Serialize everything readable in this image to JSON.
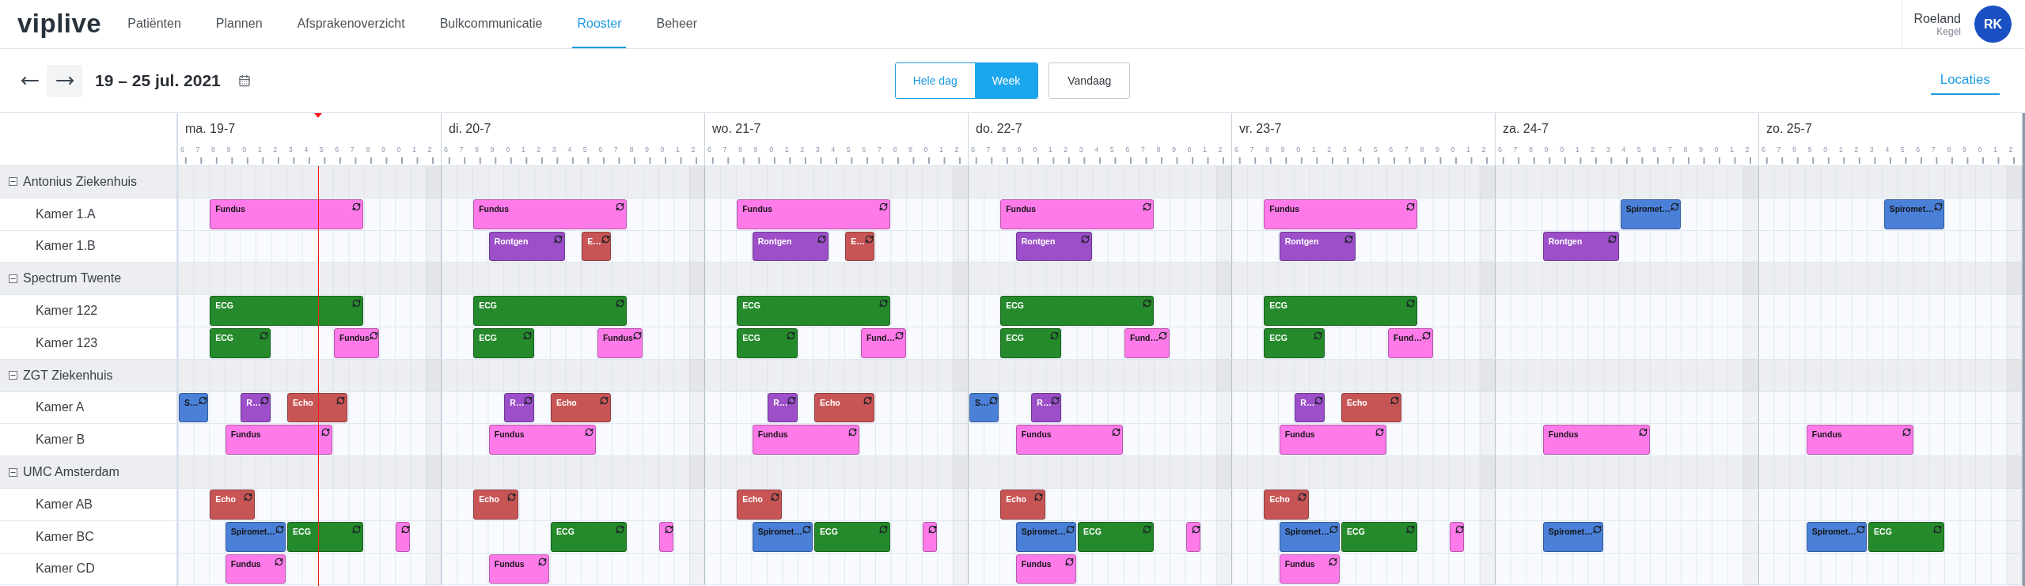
{
  "nav": {
    "logo": "viplive",
    "items": [
      {
        "label": "Patiënten",
        "selected": false
      },
      {
        "label": "Plannen",
        "selected": false
      },
      {
        "label": "Afsprakenoverzicht",
        "selected": false
      },
      {
        "label": "Bulkcommunicatie",
        "selected": false
      },
      {
        "label": "Rooster",
        "selected": true
      },
      {
        "label": "Beheer",
        "selected": false
      }
    ]
  },
  "user": {
    "first_name": "Roeland",
    "last_name": "Kegel",
    "initials": "RK"
  },
  "toolbar": {
    "range_title": "19 – 25 jul. 2021",
    "view_toggle": [
      {
        "label": "Hele dag",
        "selected": false
      },
      {
        "label": "Week",
        "selected": true
      }
    ],
    "today_button": "Vandaag",
    "tabs": [
      {
        "label": "Locaties",
        "selected": true
      }
    ]
  },
  "timeline": {
    "days": [
      {
        "label": "ma. 19-7",
        "hours": [
          "6",
          "7",
          "8",
          "9",
          "0",
          "1",
          "2",
          "3",
          "4",
          "5",
          "6",
          "7",
          "8",
          "9",
          "0",
          "1",
          "2"
        ]
      },
      {
        "label": "di. 20-7",
        "hours": [
          "6",
          "7",
          "8",
          "9",
          "0",
          "1",
          "2",
          "3",
          "4",
          "5",
          "6",
          "7",
          "8",
          "9",
          "0",
          "1",
          "2"
        ]
      },
      {
        "label": "wo. 21-7",
        "hours": [
          "6",
          "7",
          "8",
          "9",
          "0",
          "1",
          "2",
          "3",
          "4",
          "5",
          "6",
          "7",
          "8",
          "9",
          "0",
          "1",
          "2"
        ]
      },
      {
        "label": "do. 22-7",
        "hours": [
          "6",
          "7",
          "8",
          "9",
          "0",
          "1",
          "2",
          "3",
          "4",
          "5",
          "6",
          "7",
          "8",
          "9",
          "0",
          "1",
          "2"
        ]
      },
      {
        "label": "vr. 23-7",
        "hours": [
          "6",
          "7",
          "8",
          "9",
          "0",
          "1",
          "2",
          "3",
          "4",
          "5",
          "6",
          "7",
          "8",
          "9",
          "0",
          "1",
          "2"
        ]
      },
      {
        "label": "za. 24-7",
        "hours": [
          "6",
          "7",
          "8",
          "9",
          "0",
          "1",
          "2",
          "3",
          "4",
          "5",
          "6",
          "7",
          "8",
          "9",
          "0",
          "1",
          "2"
        ]
      },
      {
        "label": "zo. 25-7",
        "hours": [
          "6",
          "7",
          "8",
          "9",
          "0",
          "1",
          "2",
          "3",
          "4",
          "5",
          "6",
          "7",
          "8",
          "9",
          "0",
          "1",
          "2"
        ]
      }
    ]
  },
  "groups": [
    {
      "name": "Antonius Ziekenhuis",
      "expanded": true,
      "rooms": [
        {
          "name": "Kamer 1.A",
          "events": [
            {
              "label": "Fundus",
              "color": "#ff7ae9",
              "recurring": true
            },
            {
              "label": "Fundus",
              "color": "#ff7ae9",
              "recurring": true
            },
            {
              "label": "Fundus",
              "color": "#ff7ae9",
              "recurring": true
            },
            {
              "label": "Fundus",
              "color": "#ff7ae9",
              "recurring": true
            },
            {
              "label": "Fundus",
              "color": "#ff7ae9",
              "recurring": true
            },
            {
              "label": "Spiromet…",
              "color": "#4a80d8",
              "recurring": true
            },
            {
              "label": "Spiromet…",
              "color": "#4a80d8",
              "recurring": true
            }
          ]
        },
        {
          "name": "Kamer 1.B",
          "events": [
            {
              "label": "Rontgen",
              "color": "#9c4fc8",
              "recurring": true
            },
            {
              "label": "E…",
              "color": "#c85555",
              "recurring": true
            },
            {
              "label": "Rontgen",
              "color": "#9c4fc8",
              "recurring": true
            },
            {
              "label": "E…",
              "color": "#c85555",
              "recurring": true
            },
            {
              "label": "Rontgen",
              "color": "#9c4fc8",
              "recurring": true
            },
            {
              "label": "Rontgen",
              "color": "#9c4fc8",
              "recurring": true
            },
            {
              "label": "Rontgen",
              "color": "#9c4fc8",
              "recurring": true
            }
          ]
        }
      ]
    },
    {
      "name": "Spectrum Twente",
      "expanded": true,
      "rooms": [
        {
          "name": "Kamer 122",
          "events": [
            {
              "label": "ECG",
              "color": "#258a2b",
              "recurring": true
            },
            {
              "label": "ECG",
              "color": "#258a2b",
              "recurring": true
            },
            {
              "label": "ECG",
              "color": "#258a2b",
              "recurring": true
            },
            {
              "label": "ECG",
              "color": "#258a2b",
              "recurring": true
            },
            {
              "label": "ECG",
              "color": "#258a2b",
              "recurring": true
            }
          ]
        },
        {
          "name": "Kamer 123",
          "events": [
            {
              "label": "ECG",
              "color": "#258a2b",
              "recurring": true
            },
            {
              "label": "Fundus",
              "color": "#ff7ae9",
              "recurring": true
            },
            {
              "label": "ECG",
              "color": "#258a2b",
              "recurring": true
            },
            {
              "label": "Fundus",
              "color": "#ff7ae9",
              "recurring": true
            },
            {
              "label": "ECG",
              "color": "#258a2b",
              "recurring": true
            },
            {
              "label": "Fund…",
              "color": "#ff7ae9",
              "recurring": true
            },
            {
              "label": "ECG",
              "color": "#258a2b",
              "recurring": true
            },
            {
              "label": "Fund…",
              "color": "#ff7ae9",
              "recurring": true
            },
            {
              "label": "ECG",
              "color": "#258a2b",
              "recurring": true
            },
            {
              "label": "Fund…",
              "color": "#ff7ae9",
              "recurring": true
            }
          ]
        }
      ]
    },
    {
      "name": "ZGT Ziekenhuis",
      "expanded": true,
      "rooms": [
        {
          "name": "Kamer A",
          "events": [
            {
              "label": "S…",
              "color": "#4a80d8",
              "recurring": true
            },
            {
              "label": "R…",
              "color": "#9c4fc8",
              "recurring": true
            },
            {
              "label": "Echo",
              "color": "#c85555",
              "recurring": true
            },
            {
              "label": "R…",
              "color": "#9c4fc8",
              "recurring": true
            },
            {
              "label": "Echo",
              "color": "#c85555",
              "recurring": true
            },
            {
              "label": "R…",
              "color": "#9c4fc8",
              "recurring": true
            },
            {
              "label": "Echo",
              "color": "#c85555",
              "recurring": true
            },
            {
              "label": "S…",
              "color": "#4a80d8",
              "recurring": true
            },
            {
              "label": "R…",
              "color": "#9c4fc8",
              "recurring": true
            },
            {
              "label": "R…",
              "color": "#9c4fc8",
              "recurring": true
            },
            {
              "label": "Echo",
              "color": "#c85555",
              "recurring": true
            }
          ]
        },
        {
          "name": "Kamer B",
          "events": [
            {
              "label": "Fundus",
              "color": "#ff7ae9",
              "recurring": true
            },
            {
              "label": "Fundus",
              "color": "#ff7ae9",
              "recurring": true
            },
            {
              "label": "Fundus",
              "color": "#ff7ae9",
              "recurring": true
            },
            {
              "label": "Fundus",
              "color": "#ff7ae9",
              "recurring": true
            },
            {
              "label": "Fundus",
              "color": "#ff7ae9",
              "recurring": true
            },
            {
              "label": "Fundus",
              "color": "#ff7ae9",
              "recurring": true
            },
            {
              "label": "Fundus",
              "color": "#ff7ae9",
              "recurring": true
            }
          ]
        }
      ]
    },
    {
      "name": "UMC Amsterdam",
      "expanded": true,
      "rooms": [
        {
          "name": "Kamer AB",
          "events": [
            {
              "label": "Echo",
              "color": "#c85555",
              "recurring": true
            },
            {
              "label": "Echo",
              "color": "#c85555",
              "recurring": true
            },
            {
              "label": "Echo",
              "color": "#c85555",
              "recurring": true
            },
            {
              "label": "Echo",
              "color": "#c85555",
              "recurring": true
            },
            {
              "label": "Echo",
              "color": "#c85555",
              "recurring": true
            }
          ]
        },
        {
          "name": "Kamer BC",
          "events": [
            {
              "label": "Spiromet…",
              "color": "#4a80d8",
              "recurring": true
            },
            {
              "label": "ECG",
              "color": "#258a2b",
              "recurring": true
            },
            {
              "color": "#ff7ae9",
              "recurring": true
            },
            {
              "label": "ECG",
              "color": "#258a2b",
              "recurring": true
            },
            {
              "color": "#ff7ae9",
              "recurring": true
            },
            {
              "label": "Spiromet…",
              "color": "#4a80d8",
              "recurring": true
            },
            {
              "label": "ECG",
              "color": "#258a2b",
              "recurring": true
            },
            {
              "color": "#ff7ae9",
              "recurring": true
            },
            {
              "label": "Spiromet…",
              "color": "#4a80d8",
              "recurring": true
            },
            {
              "label": "ECG",
              "color": "#258a2b",
              "recurring": true
            },
            {
              "color": "#ff7ae9",
              "recurring": true
            },
            {
              "label": "Spiromet…",
              "color": "#4a80d8",
              "recurring": true
            },
            {
              "label": "ECG",
              "color": "#258a2b",
              "recurring": true
            },
            {
              "color": "#ff7ae9",
              "recurring": true
            },
            {
              "label": "Spiromet…",
              "color": "#4a80d8",
              "recurring": true
            },
            {
              "label": "Spiromet…",
              "color": "#4a80d8",
              "recurring": true
            },
            {
              "label": "ECG",
              "color": "#258a2b",
              "recurring": true
            }
          ]
        },
        {
          "name": "Kamer CD",
          "events": [
            {
              "label": "Fundus",
              "color": "#ff7ae9",
              "recurring": true
            },
            {
              "label": "Fundus",
              "color": "#ff7ae9",
              "recurring": true
            },
            {
              "label": "Fundus",
              "color": "#ff7ae9",
              "recurring": true
            },
            {
              "label": "Fundus",
              "color": "#ff7ae9",
              "recurring": true
            }
          ]
        }
      ]
    }
  ]
}
